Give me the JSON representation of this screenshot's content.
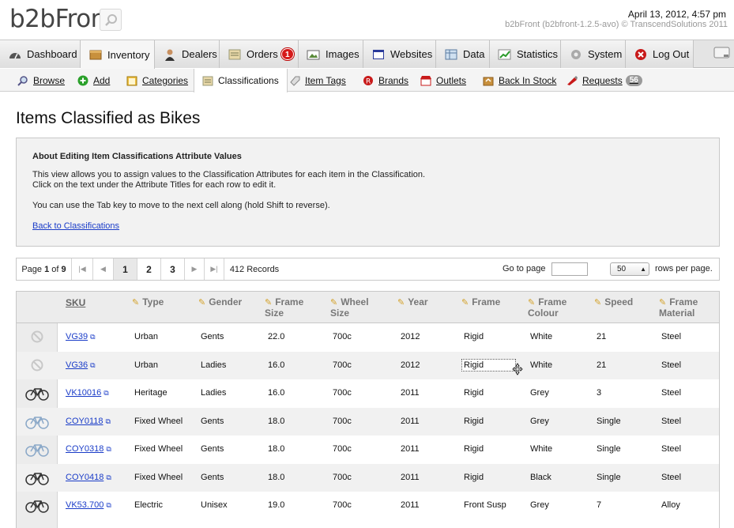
{
  "header": {
    "logo": "b2bFront",
    "date": "April 13, 2012, 4:57 pm",
    "version": "b2bFront (b2bfront-1.2.5-avo) © TranscendSolutions 2011"
  },
  "main_nav": [
    {
      "label": "Dashboard",
      "icon": "speedometer-icon"
    },
    {
      "label": "Inventory",
      "icon": "box-icon",
      "active": true
    },
    {
      "label": "Dealers",
      "icon": "person-icon"
    },
    {
      "label": "Orders",
      "icon": "orders-icon",
      "badge": "1"
    },
    {
      "label": "Images",
      "icon": "images-icon"
    },
    {
      "label": "Websites",
      "icon": "websites-icon"
    },
    {
      "label": "Data",
      "icon": "data-icon"
    },
    {
      "label": "Statistics",
      "icon": "chart-icon"
    },
    {
      "label": "System",
      "icon": "gear-icon"
    },
    {
      "label": "Log Out",
      "icon": "stop-icon"
    }
  ],
  "sub_nav": [
    {
      "label": "Browse",
      "icon": "magnifier-icon"
    },
    {
      "label": "Add",
      "icon": "plus-icon"
    },
    {
      "label": "Categories",
      "icon": "folder-icon"
    },
    {
      "label": "Classifications",
      "icon": "classification-icon",
      "active": true
    },
    {
      "label": "Item Tags",
      "icon": "tag-icon"
    },
    {
      "label": "Brands",
      "icon": "brand-icon"
    },
    {
      "label": "Outlets",
      "icon": "outlet-icon"
    },
    {
      "label": "Back In Stock",
      "icon": "stock-icon"
    },
    {
      "label": "Requests",
      "icon": "requests-icon",
      "badge": "56"
    }
  ],
  "page_title": "Items Classified as Bikes",
  "info": {
    "heading": "About Editing Item Classifications Attribute Values",
    "line1": "This view allows you to assign values to the Classification Attributes for each item in the Classification.",
    "line2": "Click on the text under the Attribute Titles for each row to edit it.",
    "line3": "You can use the Tab key to move to the next cell along (hold Shift to reverse).",
    "back_link": "Back to Classifications"
  },
  "pager": {
    "page_prefix": "Page",
    "page": "1",
    "of": "of",
    "total_pages": "9",
    "pages": [
      "1",
      "2",
      "3"
    ],
    "records": "412 Records",
    "goto_label": "Go to page",
    "rows_value": "50",
    "rows_label": "rows per page."
  },
  "table": {
    "headers": {
      "sku": "SKU",
      "type": "Type",
      "gender": "Gender",
      "frame_size_1": "Frame",
      "frame_size_2": "Size",
      "wheel_size_1": "Wheel",
      "wheel_size_2": "Size",
      "year": "Year",
      "frame": "Frame",
      "frame_colour_1": "Frame",
      "frame_colour_2": "Colour",
      "speed": "Speed",
      "frame_material_1": "Frame",
      "frame_material_2": "Material"
    },
    "rows": [
      {
        "icon": "no-image-icon",
        "sku": "VG39",
        "type": "Urban",
        "gender": "Gents",
        "frame_size": "22.0",
        "wheel_size": "700c",
        "year": "2012",
        "frame": "Rigid",
        "colour": "White",
        "speed": "21",
        "material": "Steel"
      },
      {
        "icon": "no-image-icon",
        "sku": "VG36",
        "type": "Urban",
        "gender": "Ladies",
        "frame_size": "16.0",
        "wheel_size": "700c",
        "year": "2012",
        "frame": "Rigid",
        "colour": "White",
        "speed": "21",
        "material": "Steel"
      },
      {
        "icon": "bike-icon",
        "sku": "VK10016",
        "type": "Heritage",
        "gender": "Ladies",
        "frame_size": "16.0",
        "wheel_size": "700c",
        "year": "2011",
        "frame": "Rigid",
        "colour": "Grey",
        "speed": "3",
        "material": "Steel"
      },
      {
        "icon": "bike-icon",
        "sku": "COY0118",
        "type": "Fixed Wheel",
        "gender": "Gents",
        "frame_size": "18.0",
        "wheel_size": "700c",
        "year": "2011",
        "frame": "Rigid",
        "colour": "Grey",
        "speed": "Single",
        "material": "Steel"
      },
      {
        "icon": "bike-icon",
        "sku": "COY0318",
        "type": "Fixed Wheel",
        "gender": "Gents",
        "frame_size": "18.0",
        "wheel_size": "700c",
        "year": "2011",
        "frame": "Rigid",
        "colour": "White",
        "speed": "Single",
        "material": "Steel"
      },
      {
        "icon": "bike-icon",
        "sku": "COY0418",
        "type": "Fixed Wheel",
        "gender": "Gents",
        "frame_size": "18.0",
        "wheel_size": "700c",
        "year": "2011",
        "frame": "Rigid",
        "colour": "Black",
        "speed": "Single",
        "material": "Steel"
      },
      {
        "icon": "bike-icon",
        "sku": "VK53.700",
        "type": "Electric",
        "gender": "Unisex",
        "frame_size": "19.0",
        "wheel_size": "700c",
        "year": "2011",
        "frame": "Front Susp",
        "colour": "Grey",
        "speed": "7",
        "material": "Alloy"
      }
    ]
  }
}
